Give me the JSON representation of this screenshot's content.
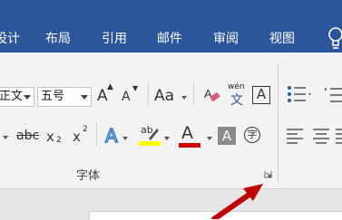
{
  "tabs": [
    "设计",
    "布局",
    "引用",
    "邮件",
    "审阅",
    "视图"
  ],
  "font": {
    "name": "正文",
    "size": "五号"
  },
  "buttons": {
    "grow_font": "A",
    "shrink_font": "A",
    "change_case": "Aa",
    "phonetic_top": "wén",
    "phonetic_bottom": "文",
    "char_border": "A",
    "strikethrough": "abc",
    "subscript_base": "x",
    "subscript_sub": "2",
    "superscript_base": "x",
    "superscript_sup": "2",
    "text_effects": "A",
    "highlight": "ab",
    "font_color": "A",
    "char_shading": "A",
    "enclose_char": "字"
  },
  "group_label": "字体",
  "colors": {
    "tab_bar": "#2b579a",
    "highlight_bar": "#ffff00",
    "font_color_bar": "#d00000",
    "annotation_arrow": "#c00000"
  }
}
